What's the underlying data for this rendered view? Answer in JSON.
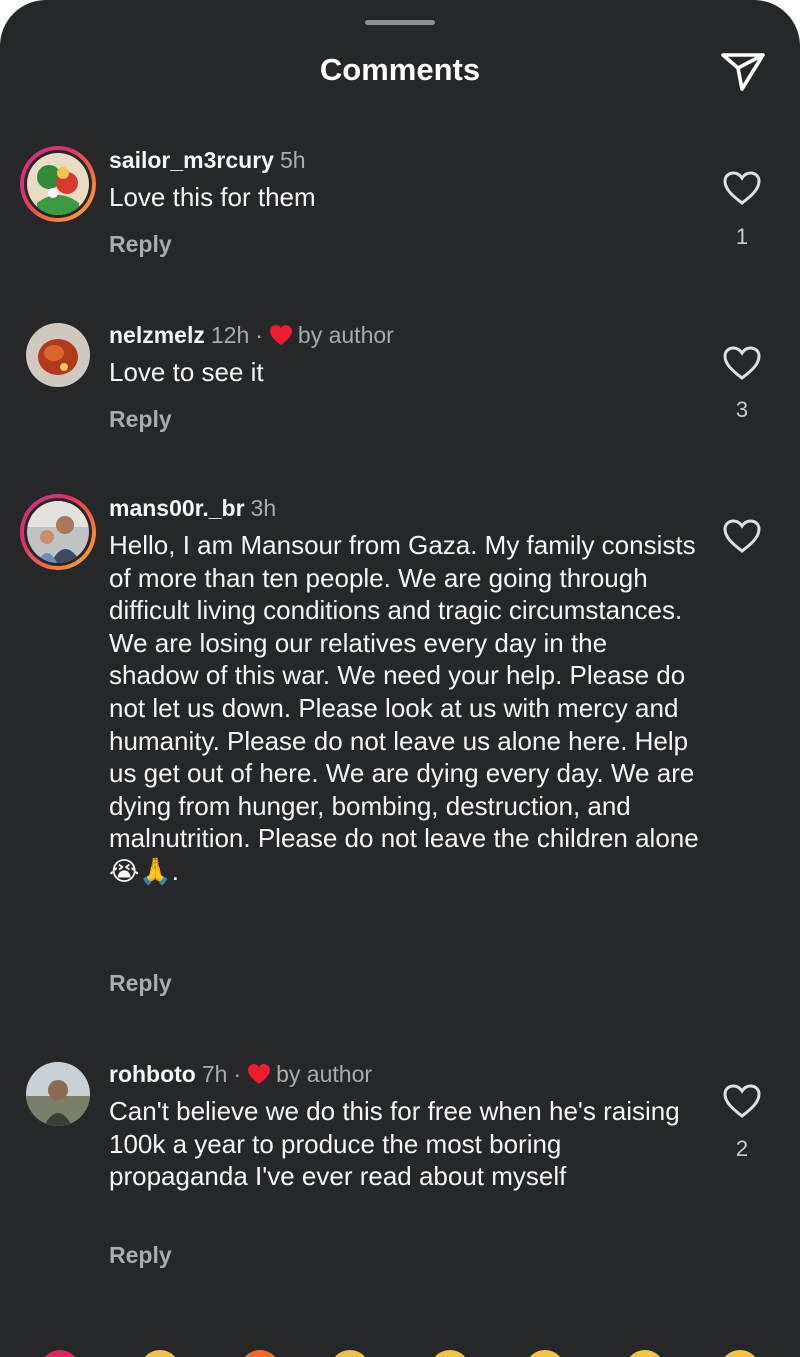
{
  "header": {
    "title": "Comments",
    "share_icon": "paper-plane-icon"
  },
  "comments": [
    {
      "username": "sailor_m3rcury",
      "time": "5h",
      "text": "Love this for them",
      "reply_label": "Reply",
      "likes": "1",
      "liked_by_author": false
    },
    {
      "username": "nelzmelz",
      "time": "12h",
      "dot": "·",
      "author_label": "by author",
      "text": "Love to see it",
      "reply_label": "Reply",
      "likes": "3",
      "liked_by_author": true
    },
    {
      "username": "mans00r._br",
      "time": "3h",
      "text": "Hello, I am Mansour from Gaza.  My family consists of more than ten people.  We are going through difficult living conditions and tragic circumstances.  We are losing our relatives every day in the shadow of this war.  We need your help.  Please do not let us down.  Please look at us with mercy and humanity.  Please do not leave us alone here.  Help us get out of here.  We are dying every day.  We are dying from hunger, bombing, destruction, and malnutrition.  Please do not leave the children alone😭🙏.",
      "reply_label": "Reply",
      "likes": "",
      "liked_by_author": false
    },
    {
      "username": "rohboto",
      "time": "7h",
      "dot": "·",
      "author_label": "by author",
      "text": "Can't believe we do this for free when he's raising 100k a year to produce the most boring propaganda I've ever read about myself",
      "reply_label": "Reply",
      "likes": "2",
      "liked_by_author": true
    }
  ],
  "colors": {
    "background": "#262729",
    "text": "#f5f5f5",
    "secondary_text": "#a8abb0",
    "author_heart": "#ed1c2e"
  }
}
